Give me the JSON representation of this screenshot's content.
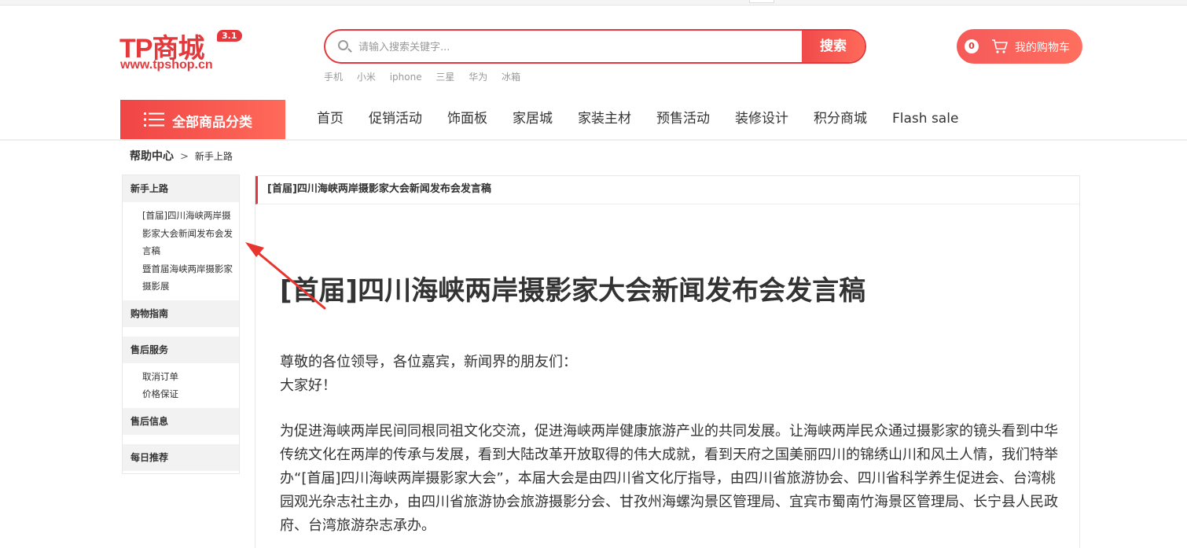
{
  "header": {
    "logo_brand": "TP商城",
    "logo_version": "3.1",
    "logo_url": "www.tpshop.cn",
    "search_placeholder": "请输入搜索关键字...",
    "search_button": "搜索",
    "hot_words": [
      "手机",
      "小米",
      "iphone",
      "三星",
      "华为",
      "冰箱"
    ],
    "cart_count": "0",
    "cart_label": "我的购物车"
  },
  "nav": {
    "all_categories": "全部商品分类",
    "items": [
      "首页",
      "促销活动",
      "饰面板",
      "家居城",
      "家装主材",
      "预售活动",
      "装修设计",
      "积分商城",
      "Flash sale"
    ]
  },
  "breadcrumb": {
    "root": "帮助中心",
    "separator": ">",
    "current": "新手上路"
  },
  "sidebar": {
    "sections": [
      {
        "title": "新手上路",
        "items": [
          "[首届]四川海峡两岸摄影家大会新闻发布会发言稿",
          "暨首届海峡两岸摄影家摄影展"
        ]
      },
      {
        "title": "购物指南",
        "items": []
      },
      {
        "title": "售后服务",
        "items": [
          "取消订单",
          "价格保证"
        ]
      },
      {
        "title": "售后信息",
        "items": []
      },
      {
        "title": "每日推荐",
        "items": []
      }
    ]
  },
  "article": {
    "header": "[首届]四川海峡两岸摄影家大会新闻发布会发言稿",
    "title": "[首届]四川海峡两岸摄影家大会新闻发布会发言稿",
    "greeting_1": "尊敬的各位领导，各位嘉宾，新闻界的朋友们：",
    "greeting_2": "大家好！",
    "paragraph": "为促进海峡两岸民间同根同祖文化交流，促进海峡两岸健康旅游产业的共同发展。让海峡两岸民众通过摄影家的镜头看到中华传统文化在两岸的传承与发展，看到大陆改革开放取得的伟大成就，看到天府之国美丽四川的锦绣山川和风土人情，我们特举办“[首届]四川海峡两岸摄影家大会”，本届大会是由四川省文化厅指导，由四川省旅游协会、四川省科学养生促进会、台湾桃园观光杂志社主办，由四川省旅游协会旅游摄影分会、甘孜州海螺沟景区管理局、宜宾市蜀南竹海景区管理局、长宁县人民政府、台湾旅游杂志承办。"
  },
  "colors": {
    "brand_red": "#e4393c",
    "annotation_red": "#e8352f"
  }
}
